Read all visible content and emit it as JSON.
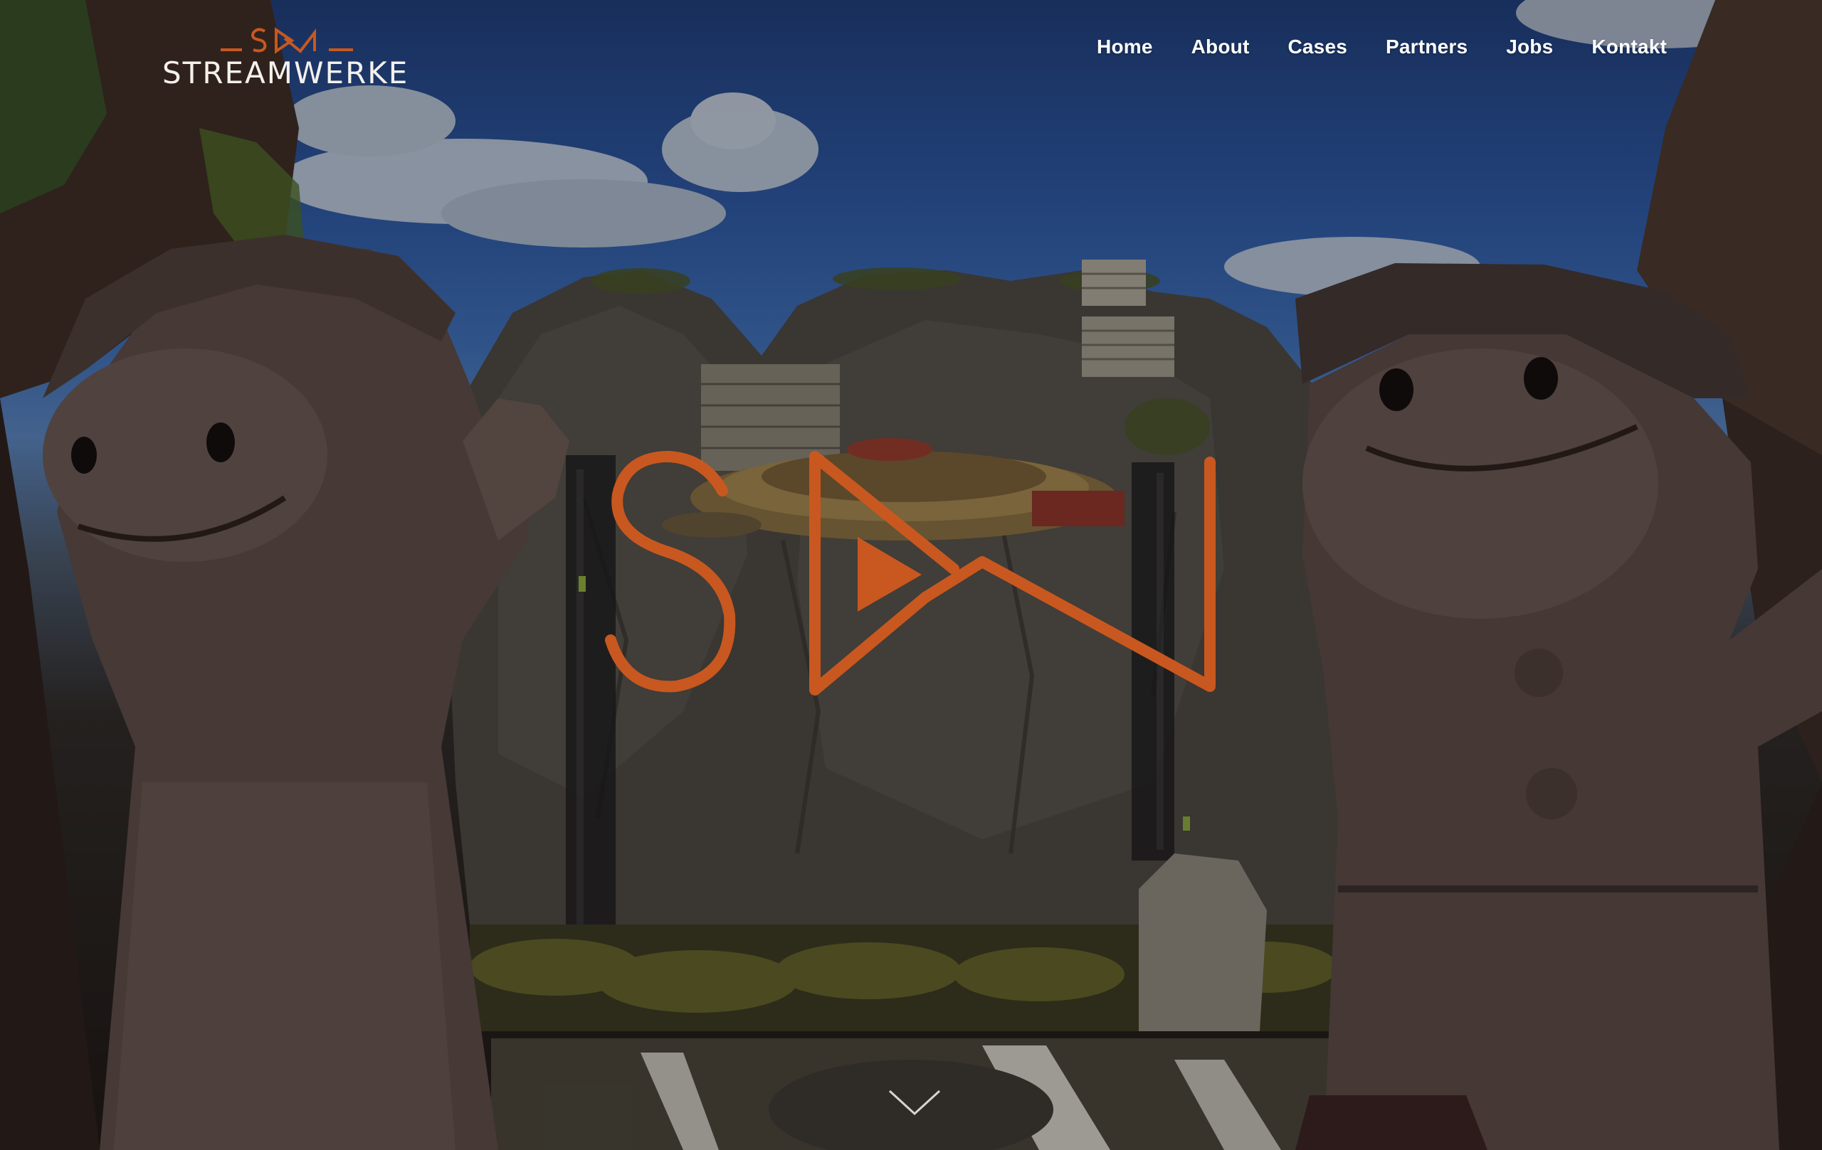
{
  "brand": {
    "logo_mark_text": "S▷W",
    "logo_wordmark": "STREAMWERKE",
    "accent_color": "#c8581f"
  },
  "nav": {
    "items": [
      {
        "label": "Home"
      },
      {
        "label": "About"
      },
      {
        "label": "Cases"
      },
      {
        "label": "Partners"
      },
      {
        "label": "Jobs"
      },
      {
        "label": "Kontakt"
      }
    ]
  },
  "hero": {
    "center_logo_icon": "sw-play-logo-icon",
    "scroll_icon": "chevron-down-icon"
  }
}
